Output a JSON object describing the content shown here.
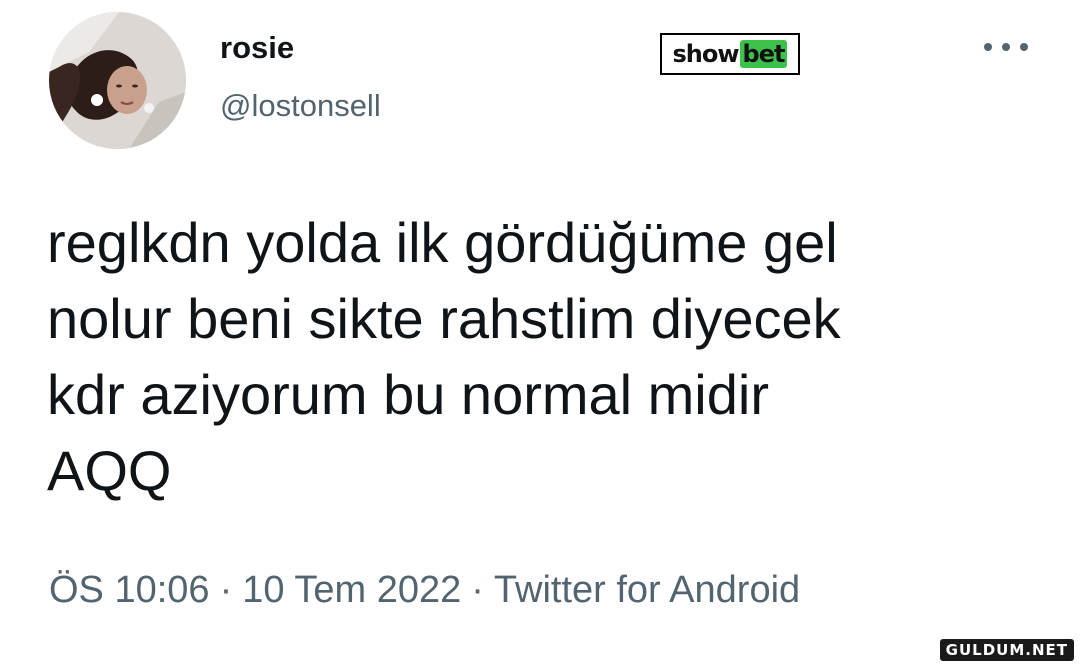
{
  "author": {
    "display_name": "rosie",
    "handle": "@lostonsell",
    "avatar_icon": "profile-photo"
  },
  "brand_logo": {
    "part_a": "show",
    "part_b": "bet",
    "accent_color": "#3cc14b"
  },
  "more_icon": "more-horizontal-icon",
  "tweet": {
    "lines": [
      "reglkdn yolda ilk gördüğüme gel",
      "nolur beni sikte rahstlim diyecek",
      "kdr aziyorum bu normal midir",
      "AQQ"
    ]
  },
  "meta": {
    "time": "ÖS 10:06",
    "separator": "·",
    "date": "10 Tem 2022",
    "source": "Twitter for Android"
  },
  "watermark": "GULDUM.NET",
  "colors": {
    "text_primary": "#0f1419",
    "text_secondary": "#536471",
    "background": "#ffffff"
  }
}
